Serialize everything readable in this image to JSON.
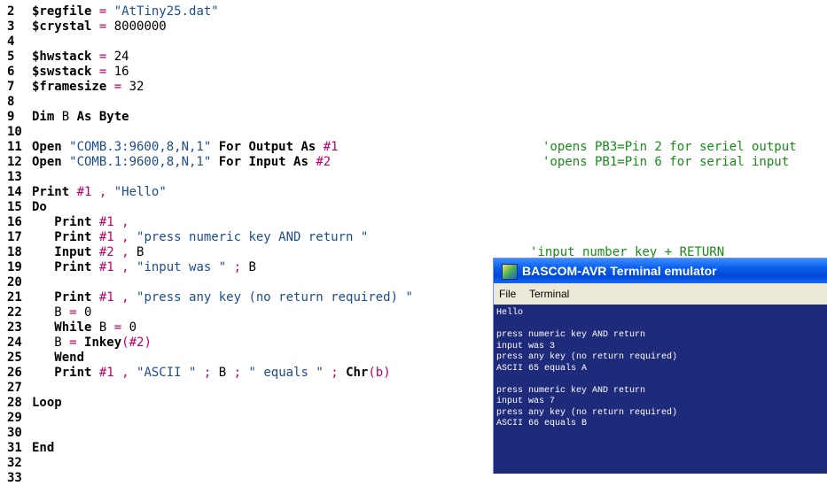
{
  "editor": {
    "lines": [
      {
        "num": "2",
        "segs": [
          {
            "t": "$regfile",
            "c": "kw"
          },
          {
            "t": " = ",
            "c": "op"
          },
          {
            "t": "\"AtTiny25.dat\"",
            "c": "str"
          }
        ]
      },
      {
        "num": "3",
        "segs": [
          {
            "t": "$crystal",
            "c": "kw"
          },
          {
            "t": " = ",
            "c": "op"
          },
          {
            "t": "8000000",
            "c": "num"
          }
        ]
      },
      {
        "num": "4",
        "segs": []
      },
      {
        "num": "5",
        "segs": [
          {
            "t": "$hwstack",
            "c": "kw"
          },
          {
            "t": " = ",
            "c": "op"
          },
          {
            "t": "24",
            "c": "num"
          }
        ]
      },
      {
        "num": "6",
        "segs": [
          {
            "t": "$swstack",
            "c": "kw"
          },
          {
            "t": " = ",
            "c": "op"
          },
          {
            "t": "16",
            "c": "num"
          }
        ]
      },
      {
        "num": "7",
        "segs": [
          {
            "t": "$framesize",
            "c": "kw"
          },
          {
            "t": " = ",
            "c": "op"
          },
          {
            "t": "32",
            "c": "num"
          }
        ]
      },
      {
        "num": "8",
        "segs": []
      },
      {
        "num": "9",
        "segs": [
          {
            "t": "Dim",
            "c": "kw"
          },
          {
            "t": " B ",
            "c": "num"
          },
          {
            "t": "As Byte",
            "c": "kw"
          }
        ]
      },
      {
        "num": "10",
        "segs": []
      },
      {
        "num": "11",
        "segs": [
          {
            "t": "Open",
            "c": "kw"
          },
          {
            "t": " \"COMB.3:9600,8,N,1\" ",
            "c": "str"
          },
          {
            "t": "For Output As",
            "c": "kw"
          },
          {
            "t": " #1",
            "c": "op"
          }
        ]
      },
      {
        "num": "12",
        "segs": [
          {
            "t": "Open",
            "c": "kw"
          },
          {
            "t": " \"COMB.1:9600,8,N,1\" ",
            "c": "str"
          },
          {
            "t": "For Input As",
            "c": "kw"
          },
          {
            "t": " #2",
            "c": "op"
          }
        ]
      },
      {
        "num": "13",
        "segs": []
      },
      {
        "num": "14",
        "segs": [
          {
            "t": "Print",
            "c": "kw"
          },
          {
            "t": " #1 ,",
            "c": "op"
          },
          {
            "t": " \"Hello\"",
            "c": "str"
          }
        ]
      },
      {
        "num": "15",
        "segs": [
          {
            "t": "Do",
            "c": "kw"
          }
        ]
      },
      {
        "num": "16",
        "segs": [
          {
            "t": "   Print",
            "c": "kw"
          },
          {
            "t": " #1 ,",
            "c": "op"
          }
        ]
      },
      {
        "num": "17",
        "segs": [
          {
            "t": "   Print",
            "c": "kw"
          },
          {
            "t": " #1 ,",
            "c": "op"
          },
          {
            "t": " \"press numeric key AND return \"",
            "c": "str"
          }
        ]
      },
      {
        "num": "18",
        "segs": [
          {
            "t": "   Input",
            "c": "kw"
          },
          {
            "t": " #2 ,",
            "c": "op"
          },
          {
            "t": " B",
            "c": "num"
          }
        ]
      },
      {
        "num": "19",
        "segs": [
          {
            "t": "   Print",
            "c": "kw"
          },
          {
            "t": " #1 ,",
            "c": "op"
          },
          {
            "t": " \"input was \"",
            "c": "str"
          },
          {
            "t": " ; ",
            "c": "op"
          },
          {
            "t": "B",
            "c": "num"
          }
        ]
      },
      {
        "num": "20",
        "segs": []
      },
      {
        "num": "21",
        "segs": [
          {
            "t": "   Print",
            "c": "kw"
          },
          {
            "t": " #1 ,",
            "c": "op"
          },
          {
            "t": " \"press any key (no return required) \"",
            "c": "str"
          }
        ]
      },
      {
        "num": "22",
        "segs": [
          {
            "t": "   B",
            "c": "num"
          },
          {
            "t": " = ",
            "c": "op"
          },
          {
            "t": "0",
            "c": "num"
          }
        ]
      },
      {
        "num": "23",
        "segs": [
          {
            "t": "   While",
            "c": "kw"
          },
          {
            "t": " B ",
            "c": "num"
          },
          {
            "t": "= ",
            "c": "op"
          },
          {
            "t": "0",
            "c": "num"
          }
        ]
      },
      {
        "num": "24",
        "segs": [
          {
            "t": "   B",
            "c": "num"
          },
          {
            "t": " = ",
            "c": "op"
          },
          {
            "t": "Inkey",
            "c": "kw"
          },
          {
            "t": "(#2)",
            "c": "op"
          }
        ]
      },
      {
        "num": "25",
        "segs": [
          {
            "t": "   Wend",
            "c": "kw"
          }
        ]
      },
      {
        "num": "26",
        "segs": [
          {
            "t": "   Print",
            "c": "kw"
          },
          {
            "t": " #1 ,",
            "c": "op"
          },
          {
            "t": " \"ASCII \"",
            "c": "str"
          },
          {
            "t": " ; ",
            "c": "op"
          },
          {
            "t": "B",
            "c": "num"
          },
          {
            "t": " ; ",
            "c": "op"
          },
          {
            "t": "\" equals \"",
            "c": "str"
          },
          {
            "t": " ; ",
            "c": "op"
          },
          {
            "t": "Chr",
            "c": "kw"
          },
          {
            "t": "(b)",
            "c": "op"
          }
        ]
      },
      {
        "num": "27",
        "segs": []
      },
      {
        "num": "28",
        "segs": [
          {
            "t": "Loop",
            "c": "kw"
          }
        ]
      },
      {
        "num": "29",
        "segs": []
      },
      {
        "num": "30",
        "segs": []
      },
      {
        "num": "31",
        "segs": [
          {
            "t": "End",
            "c": "kw"
          }
        ]
      },
      {
        "num": "32",
        "segs": []
      },
      {
        "num": "33",
        "segs": []
      }
    ],
    "comments": [
      {
        "row": 9,
        "text": "'opens PB3=Pin 2 for seriel output"
      },
      {
        "row": 10,
        "text": "'opens PB1=Pin 6 for serial input"
      },
      {
        "row": 16,
        "text": "'input number key + RETURN"
      }
    ]
  },
  "terminal": {
    "title": "BASCOM-AVR Terminal emulator",
    "menu": [
      "File",
      "Terminal"
    ],
    "lines": [
      "Hello",
      "",
      "press numeric key AND return",
      "input was 3",
      "press any key (no return required)",
      "ASCII 65 equals A",
      "",
      "press numeric key AND return",
      "input was 7",
      "press any key (no return required)",
      "ASCII 66 equals B"
    ]
  }
}
